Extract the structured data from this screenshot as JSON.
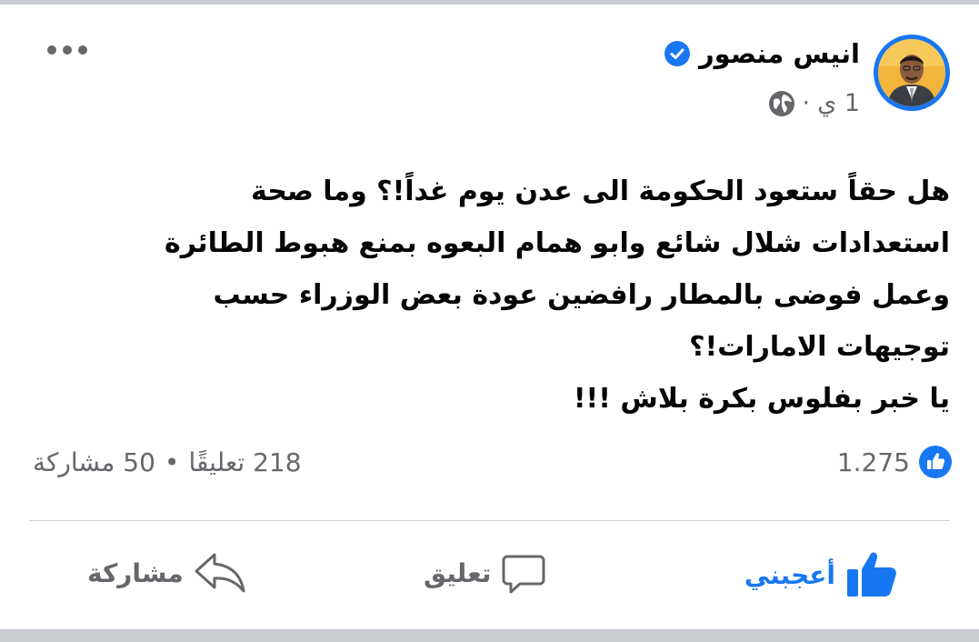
{
  "post": {
    "author": "انيس منصور",
    "verified": true,
    "time": "1 ي",
    "separator": "·",
    "audience_icon": "globe-icon",
    "more_icon": "more-options-icon",
    "text_lines": [
      "هل حقاً ستعود الحكومة الى عدن يوم غداً!؟ وما صحة",
      "استعدادات شلال شائع وابو همام البعوه بمنع هبوط الطائرة",
      "وعمل فوضى بالمطار رافضين عودة بعض الوزراء حسب",
      "توجيهات الامارات!؟",
      "يا خبر بفلوس بكرة بلاش !!!"
    ]
  },
  "reactions": {
    "count": "1.275",
    "icon": "like-badge-icon",
    "color": "#1877f2"
  },
  "stats": {
    "comments": "218 تعليقًا",
    "separator": "•",
    "shares": "50 مشاركة"
  },
  "actions": {
    "like": "أعجبني",
    "comment": "تعليق",
    "share": "مشاركة"
  },
  "colors": {
    "accent": "#1877f2",
    "secondary_text": "#65676b",
    "primary_text": "#050505",
    "divider": "#ced0d4"
  }
}
